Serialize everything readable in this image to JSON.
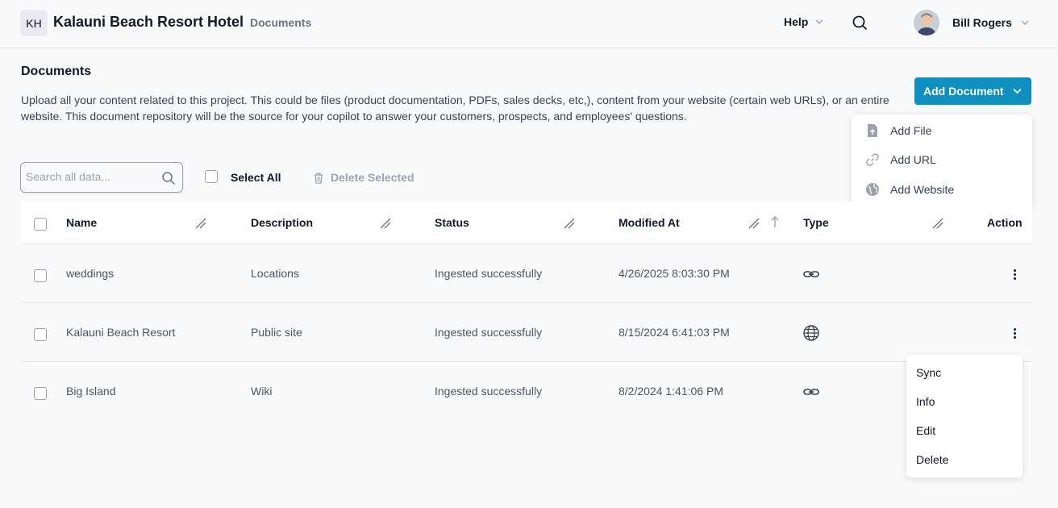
{
  "header": {
    "logo_initials": "KH",
    "app_title": "Kalauni Beach Resort Hotel",
    "breadcrumb": "Documents",
    "help_label": "Help",
    "user_name": "Bill Rogers"
  },
  "page": {
    "title": "Documents",
    "description": "Upload all your content related to this project. This could be files (product documentation, PDFs, sales decks, etc,), content from your website (certain web URLs), or an entire website. This document repository will be the source for your copilot to answer your customers, prospects, and employees' questions."
  },
  "add_document": {
    "label": "Add Document",
    "menu": [
      {
        "label": "Add File",
        "icon": "file-upload-icon"
      },
      {
        "label": "Add URL",
        "icon": "link-icon"
      },
      {
        "label": "Add Website",
        "icon": "globe-icon"
      }
    ]
  },
  "toolbar": {
    "search_placeholder": "Search all data...",
    "search_value": "",
    "select_all_label": "Select All",
    "delete_selected_label": "Delete Selected"
  },
  "table": {
    "columns": [
      "Name",
      "Description",
      "Status",
      "Modified At",
      "Type",
      "Action"
    ],
    "sorted_column": "Modified At",
    "sort_direction": "ascending",
    "rows": [
      {
        "name": "weddings",
        "description": "Locations",
        "status": "Ingested successfully",
        "modified_at": "4/26/2025 8:03:30 PM",
        "type": "link-icon"
      },
      {
        "name": "Kalauni Beach Resort",
        "description": "Public site",
        "status": "Ingested successfully",
        "modified_at": "8/15/2024 6:41:03 PM",
        "type": "globe-icon"
      },
      {
        "name": "Big Island",
        "description": "Wiki",
        "status": "Ingested successfully",
        "modified_at": "8/2/2024 1:41:06 PM",
        "type": "link-icon"
      }
    ]
  },
  "action_menu": {
    "items": [
      "Sync",
      "Info",
      "Edit",
      "Delete"
    ]
  },
  "colors": {
    "accent": "#0e8fbf",
    "background": "#f9fafb",
    "border": "#e5e7eb"
  }
}
